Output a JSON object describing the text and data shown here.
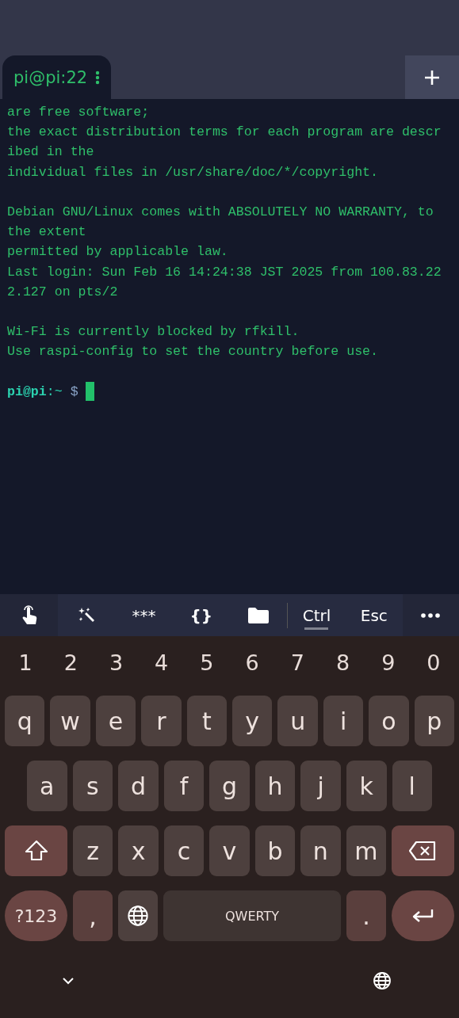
{
  "tabs": [
    {
      "label": "pi@pi:22",
      "selected": true
    }
  ],
  "terminal": {
    "blocks": [
      [
        "are free software;",
        "the exact distribution terms for each program are descr",
        "ibed in the",
        "individual files in /usr/share/doc/*/copyright."
      ],
      [
        "Debian GNU/Linux comes with ABSOLUTELY NO WARRANTY, to",
        "the extent",
        "permitted by applicable law.",
        "Last login: Sun Feb 16 14:24:38 JST 2025 from 100.83.22",
        "2.127 on pts/2"
      ],
      [
        "Wi-Fi is currently blocked by rfkill.",
        "Use raspi-config to set the country before use."
      ]
    ],
    "prompt": {
      "user_host": "pi@pi",
      "path": ":~",
      "symbol": "$"
    }
  },
  "toolbar": [
    {
      "kind": "hand"
    },
    {
      "kind": "wand"
    },
    {
      "kind": "text",
      "label": "***"
    },
    {
      "kind": "text",
      "label": "{}",
      "bold": true
    },
    {
      "kind": "folder"
    },
    {
      "kind": "separator"
    },
    {
      "kind": "text",
      "label": "Ctrl",
      "underline": true
    },
    {
      "kind": "text",
      "label": "Esc"
    },
    {
      "kind": "more"
    }
  ],
  "keyboard": {
    "numbers": [
      "1",
      "2",
      "3",
      "4",
      "5",
      "6",
      "7",
      "8",
      "9",
      "0"
    ],
    "rows": [
      [
        "q",
        "w",
        "e",
        "r",
        "t",
        "y",
        "u",
        "i",
        "o",
        "p"
      ],
      [
        "a",
        "s",
        "d",
        "f",
        "g",
        "h",
        "j",
        "k",
        "l"
      ],
      [
        "z",
        "x",
        "c",
        "v",
        "b",
        "n",
        "m"
      ]
    ],
    "symbols_key": "?123",
    "comma": ",",
    "space": "QWERTY",
    "period": "."
  }
}
